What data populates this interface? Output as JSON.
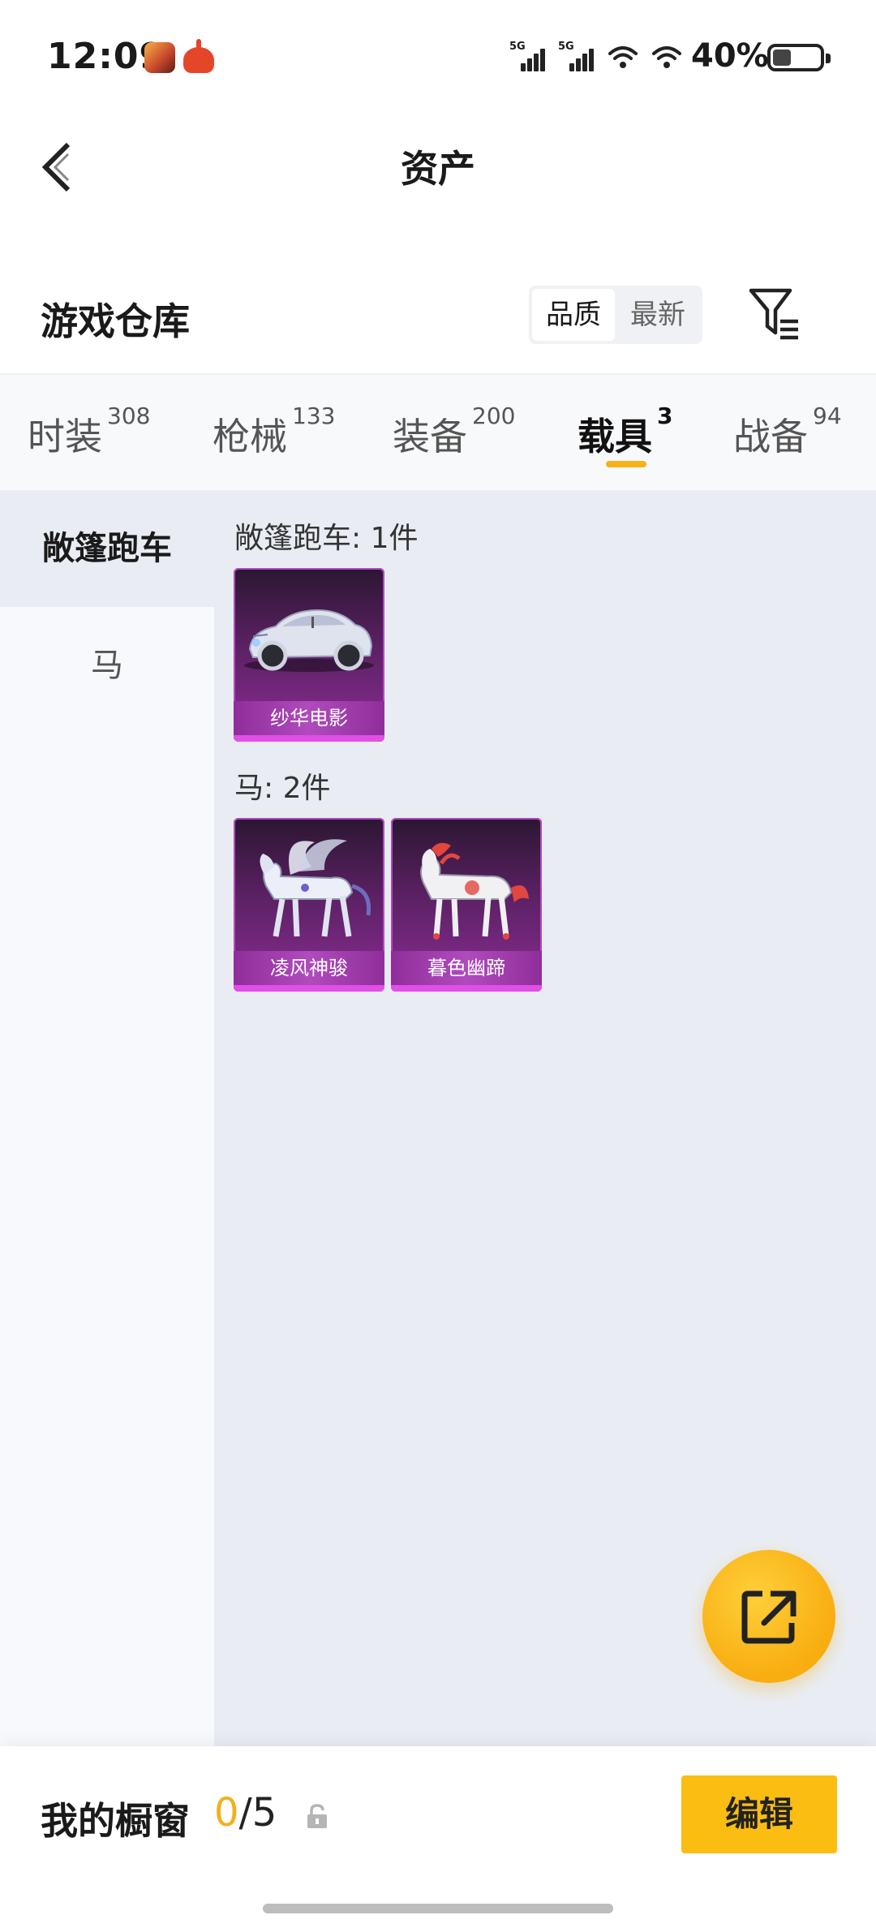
{
  "status_bar": {
    "time": "12:09",
    "signal_1_label": "5G",
    "signal_2_label": "5G",
    "battery_percent": "40%",
    "battery_level": 0.4
  },
  "header": {
    "title": "资产"
  },
  "warehouse": {
    "title": "游戏仓库",
    "sort_options": [
      "品质",
      "最新"
    ],
    "sort_selected": "品质"
  },
  "tabs": [
    {
      "label": "时装",
      "count": "308"
    },
    {
      "label": "枪械",
      "count": "133"
    },
    {
      "label": "装备",
      "count": "200"
    },
    {
      "label": "载具",
      "count": "3",
      "active": true
    },
    {
      "label": "战备",
      "count": "94"
    }
  ],
  "sidebar": {
    "items": [
      {
        "label": "敞篷跑车",
        "active": true
      },
      {
        "label": "马",
        "active": false
      }
    ]
  },
  "groups": [
    {
      "label": "敞篷跑车: 1件",
      "items": [
        {
          "name": "纱华电影",
          "icon": "convertible-car-image"
        }
      ]
    },
    {
      "label": "马: 2件",
      "items": [
        {
          "name": "凌风神骏",
          "icon": "winged-horse-image"
        },
        {
          "name": "暮色幽蹄",
          "icon": "white-red-horse-image"
        }
      ]
    }
  ],
  "fab": {
    "icon": "share-external-icon"
  },
  "bottom_bar": {
    "showcase_label": "我的橱窗",
    "showcase_current": "0",
    "showcase_total": "/5",
    "edit_label": "编辑"
  },
  "colors": {
    "accent": "#f7b21a",
    "card_purple": "#5b2163",
    "content_bg": "#e9edf3"
  }
}
